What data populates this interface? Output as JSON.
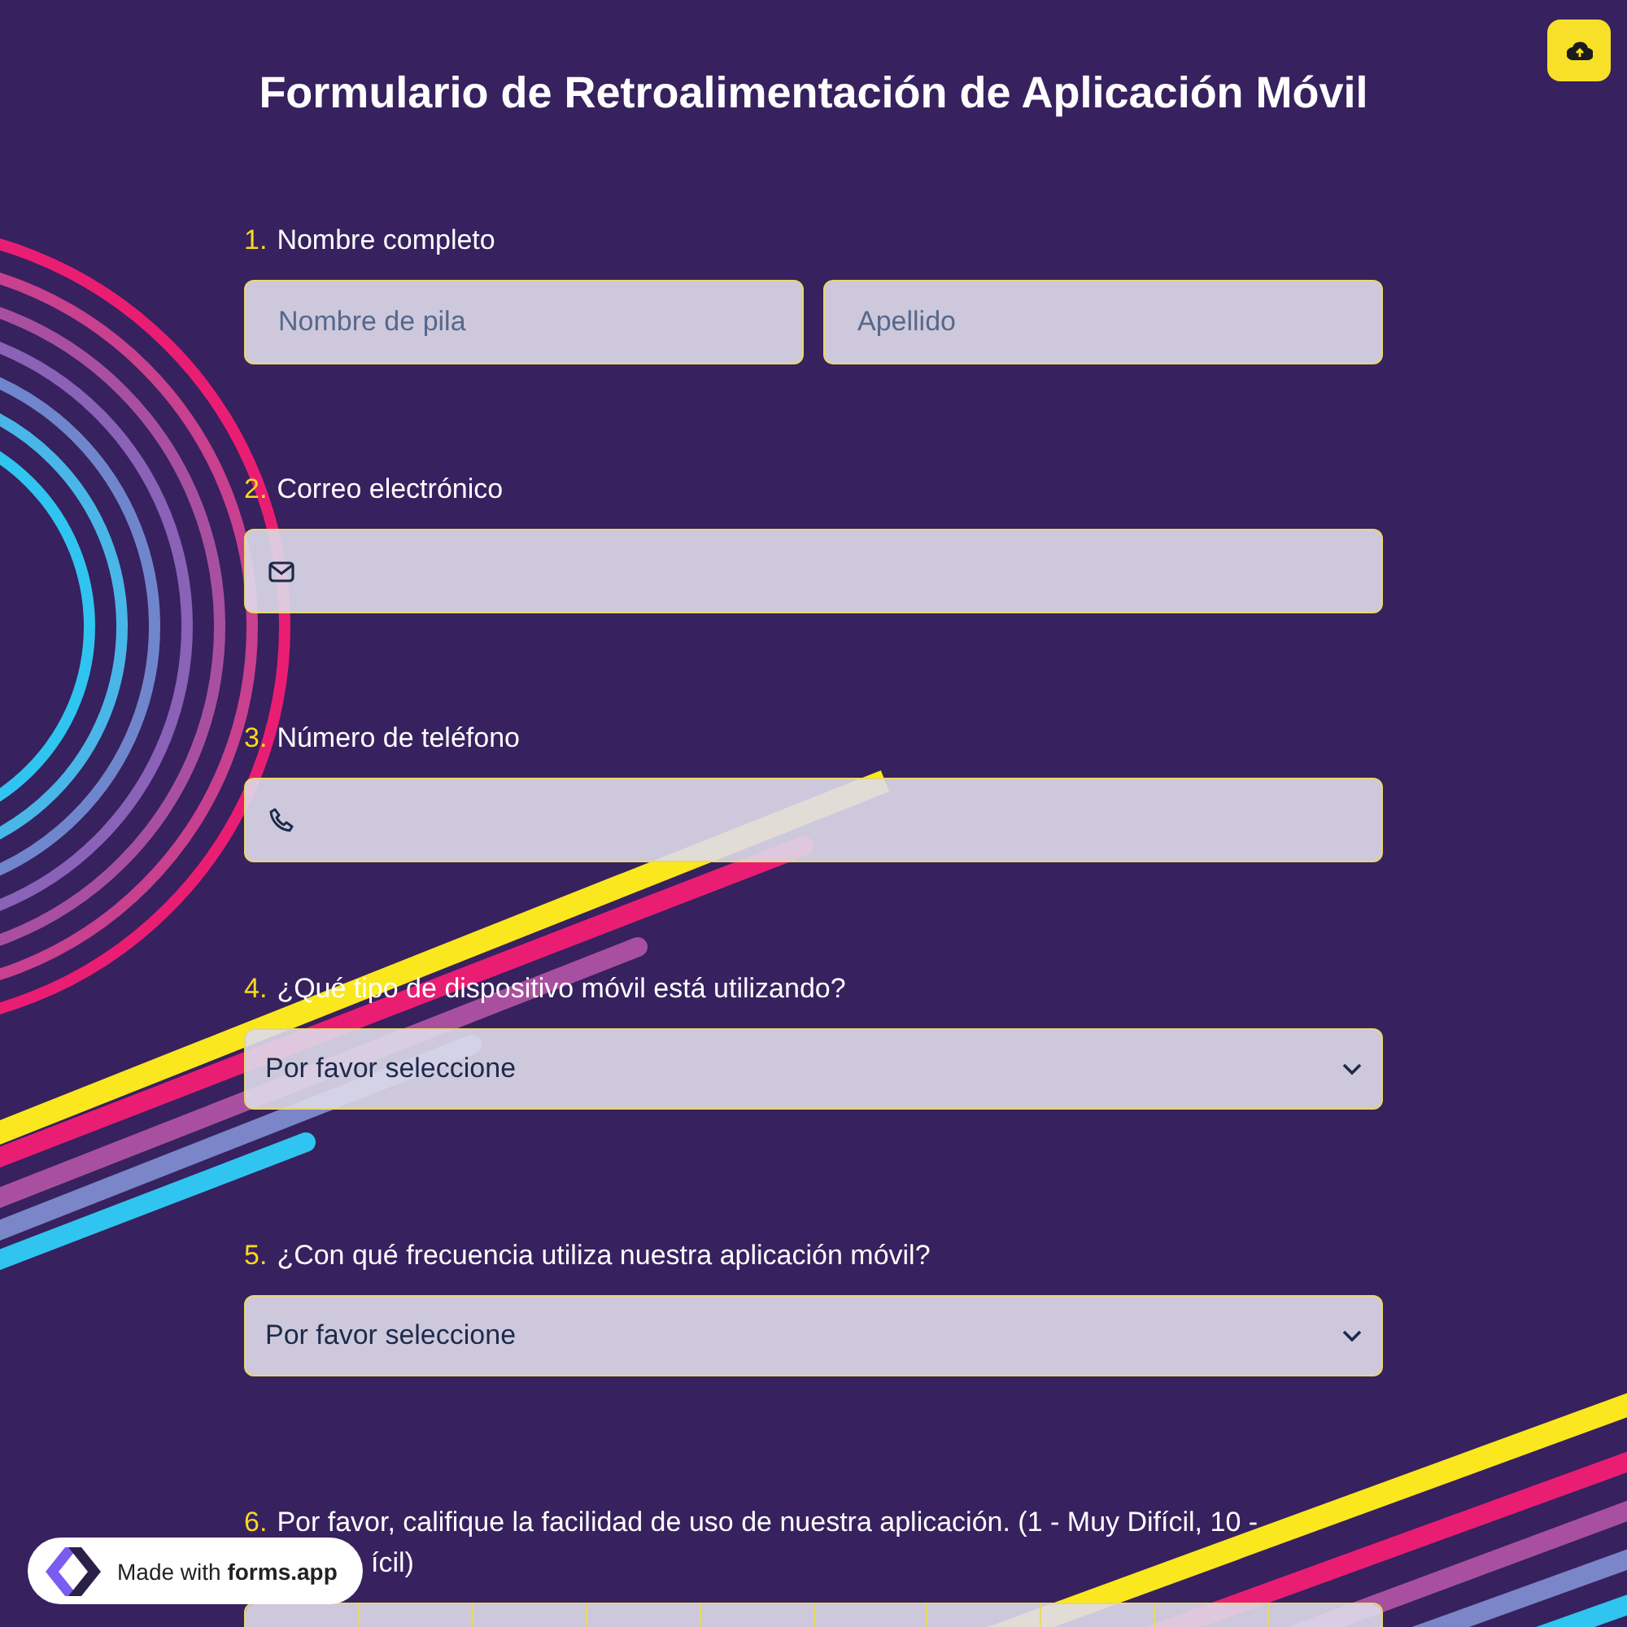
{
  "upload_button": {
    "kind": "upload"
  },
  "title": "Formulario de Retroalimentación de Aplicación Móvil",
  "questions": [
    {
      "number": "1.",
      "label": "Nombre completo",
      "kind": "name",
      "fields": [
        {
          "placeholder": "Nombre de pila"
        },
        {
          "placeholder": "Apellido"
        }
      ]
    },
    {
      "number": "2.",
      "label": "Correo electrónico",
      "kind": "email"
    },
    {
      "number": "3.",
      "label": "Número de teléfono",
      "kind": "phone"
    },
    {
      "number": "4.",
      "label": "¿Qué tipo de dispositivo móvil está utilizando?",
      "kind": "select",
      "value": "Por favor seleccione"
    },
    {
      "number": "5.",
      "label": "¿Con qué frecuencia utiliza nuestra aplicación móvil?",
      "kind": "select",
      "value": "Por favor seleccione"
    },
    {
      "number": "6.",
      "label": "Por favor, califique la facilidad de uso de nuestra aplicación. (1 - Muy Difícil, 10 -",
      "label_continuation": "ícil)",
      "kind": "rating",
      "options": [
        {
          "selected": false
        },
        {
          "selected": false
        },
        {
          "selected": false
        },
        {
          "selected": false
        },
        {
          "selected": false
        },
        {
          "selected": false
        },
        {
          "selected": false
        },
        {
          "selected": false
        },
        {
          "selected": false
        },
        {
          "selected": false
        }
      ]
    }
  ],
  "badge": {
    "text": "Made with **forms.app**"
  }
}
